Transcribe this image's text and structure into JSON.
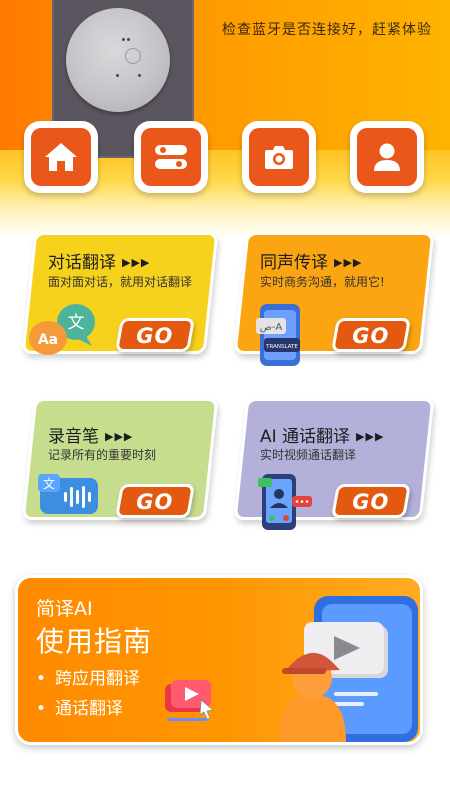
{
  "hero": {
    "tip_text": "检查蓝牙是否连接好，赶紧体验"
  },
  "nav": [
    {
      "name": "home",
      "icon": "home-icon"
    },
    {
      "name": "settings",
      "icon": "toggle-icon"
    },
    {
      "name": "camera",
      "icon": "camera-icon"
    },
    {
      "name": "profile",
      "icon": "user-icon"
    }
  ],
  "cards": {
    "dialog": {
      "title": "对话翻译",
      "arrows": "▶▶▶",
      "subtitle": "面对面对话，就用对话翻译",
      "go": "GO",
      "color": "#f7d21c"
    },
    "simul": {
      "title": "同声传译",
      "arrows": "▶▶▶",
      "subtitle": "实时商务沟通，就用它!",
      "go": "GO",
      "color": "#fba512",
      "icon_text": "TRANSLATE"
    },
    "recorder": {
      "title": "录音笔",
      "arrows": "▶▶▶",
      "subtitle": "记录所有的重要时刻",
      "go": "GO",
      "color": "#c7dd8e"
    },
    "ai_call": {
      "title": "AI 通话翻译",
      "arrows": "▶▶▶",
      "subtitle": "实时视频通话翻译",
      "go": "GO",
      "color": "#b3b0da"
    }
  },
  "guide": {
    "brand": "简译AI",
    "title": "使用指南",
    "items": [
      "跨应用翻译",
      "通话翻译"
    ]
  },
  "colors": {
    "accent": "#e2590f",
    "hero_orange": "#ff8d00"
  }
}
